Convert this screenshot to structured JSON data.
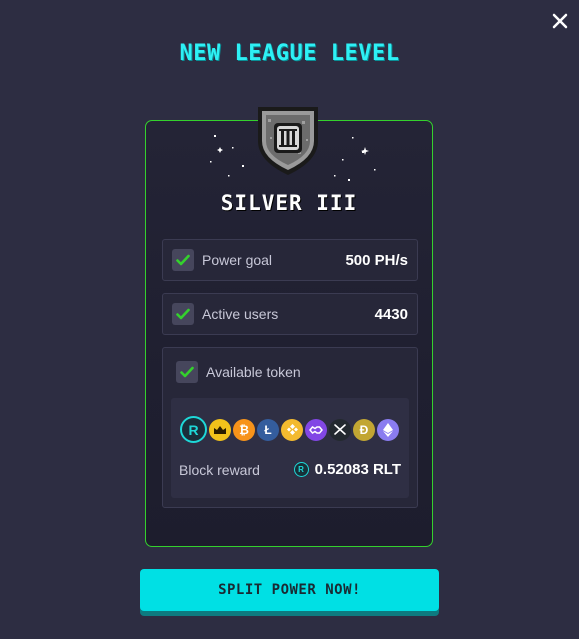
{
  "modal": {
    "title": "NEW LEAGUE LEVEL",
    "league_name": "SILVER III",
    "badge_numeral": "III"
  },
  "requirements": [
    {
      "label": "Power goal",
      "value": "500 PH/s",
      "checked": true
    },
    {
      "label": "Active users",
      "value": "4430",
      "checked": true
    }
  ],
  "token": {
    "label": "Available token",
    "checked": true,
    "coins": [
      "rlt-icon",
      "crown-token-icon",
      "bitcoin-icon",
      "litecoin-icon",
      "binance-icon",
      "polygon-icon",
      "xrp-icon",
      "dogecoin-icon",
      "ethereum-icon"
    ],
    "block_reward_label": "Block reward",
    "block_reward_value": "0.52083 RLT"
  },
  "cta": {
    "label": "SPLIT POWER NOW!"
  },
  "colors": {
    "accent_cyan": "#00e0e4",
    "card_border_green": "#34d12d",
    "check_green": "#34d12d",
    "background": "#2d2d42"
  }
}
